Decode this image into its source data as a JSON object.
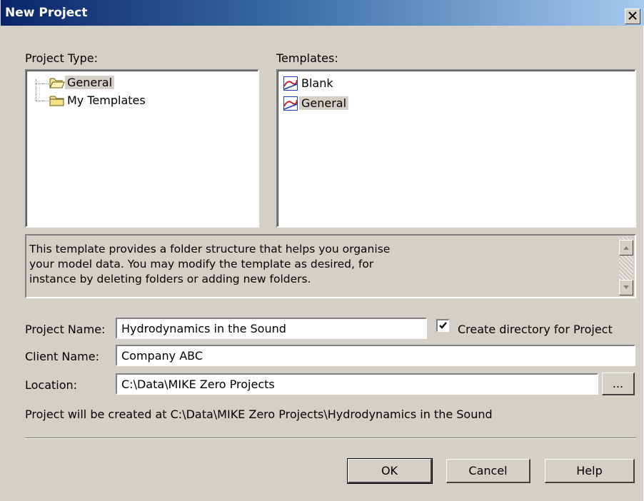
{
  "dialog": {
    "title": "New Project",
    "close_label": "×"
  },
  "project_type": {
    "label": "Project Type:",
    "items": [
      {
        "label": "General",
        "selected": true
      },
      {
        "label": "My Templates",
        "selected": false
      }
    ]
  },
  "templates": {
    "label": "Templates:",
    "items": [
      {
        "label": "Blank",
        "selected": false
      },
      {
        "label": "General",
        "selected": true
      }
    ]
  },
  "description": {
    "text": "This template provides a folder structure that helps you organise\nyour model data. You may modify the template as desired, for\ninstance by deleting folders or adding new folders."
  },
  "form": {
    "project_name_label": "Project Name:",
    "project_name_value": "Hydrodynamics in the Sound",
    "create_directory_label": "Create directory for Project",
    "create_directory_checked": true,
    "client_name_label": "Client Name:",
    "client_name_value": "Company ABC",
    "location_label": "Location:",
    "location_value": "C:\\Data\\MIKE Zero Projects",
    "browse_label": "...",
    "status_text": "Project will be created at C:\\Data\\MIKE Zero Projects\\Hydrodynamics in the Sound"
  },
  "buttons": {
    "ok": "OK",
    "cancel": "Cancel",
    "help": "Help"
  },
  "icons": {
    "folder": "folder-icon",
    "template": "template-icon",
    "close": "close-icon",
    "scroll_up": "scroll-up-arrow-icon",
    "scroll_down": "scroll-down-arrow-icon",
    "checkmark": "checkmark-icon"
  },
  "colors": {
    "title_gradient_start": "#0a246a",
    "title_gradient_end": "#a6caf0",
    "dialog_face": "#d4d0c8"
  }
}
